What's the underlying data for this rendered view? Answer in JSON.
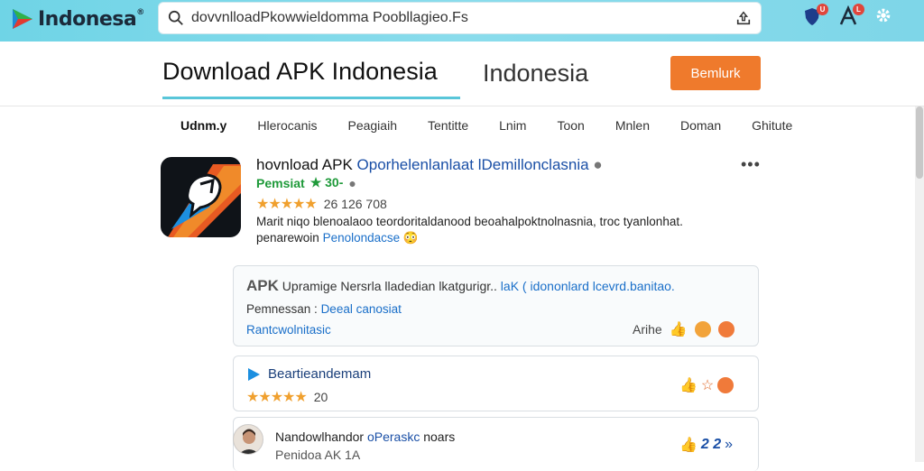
{
  "brand": {
    "logo_text": "Indonesa",
    "logo_mark": "®"
  },
  "search": {
    "value": "dovvnlloadPkowwieldomma Poobllagieo.Fs"
  },
  "top_icons": [
    {
      "name": "shield-icon",
      "badge": "U"
    },
    {
      "name": "font-icon",
      "badge": "L"
    },
    {
      "name": "gear-icon",
      "badge": ""
    }
  ],
  "header": {
    "title": "Download APK Indonesia",
    "subtitle": "Indonesia",
    "button_label": "Bemlurk"
  },
  "tabs": [
    "Udnm.y",
    "Hlerocanis",
    "Peagiaih",
    "Tentitte",
    "Lnim",
    "Toon",
    "Mnlen",
    "Doman",
    "Ghitute"
  ],
  "app": {
    "name_plain": "hovnload APK",
    "name_link": "Oporhelenlanlaat lDemillonclasnia",
    "developer": "Pemsiat",
    "developer_badge": "★ 30-",
    "rating_count": "26  126 708",
    "desc_line1": "Marit niqo blenoalaoo teordoritaldanood beoahalpoktnolnasnia, troc tyanlonhat.",
    "desc_line2_plain": "penarewoin",
    "desc_line2_link": "Penolondacse"
  },
  "card1": {
    "apk_label": "APK",
    "title_plain": "Upramige Nersrla lladedian lkatgurigr..",
    "title_link": "laK ( idononlard lcevrd.banitao.",
    "line2_label": "Pemnessan :",
    "line2_link": "Deeal canosiat",
    "line3": "Rantcwolnitasic",
    "right_label": "Arihe"
  },
  "card2": {
    "title": "Beartieandemam",
    "rating": "20"
  },
  "card3": {
    "title_plain": "Nandowlhandor",
    "title_link": "oPeraskc",
    "title_suffix": "noars",
    "subtitle": "Penidoa AK 1A",
    "reaction_text": "2 2"
  },
  "colors": {
    "topbar": "#7ed6e8",
    "accent": "#59c6d9",
    "button": "#ef7a2c",
    "link": "#1a6fc9",
    "stars": "#f0a02e",
    "developer": "#1f9a3a"
  }
}
